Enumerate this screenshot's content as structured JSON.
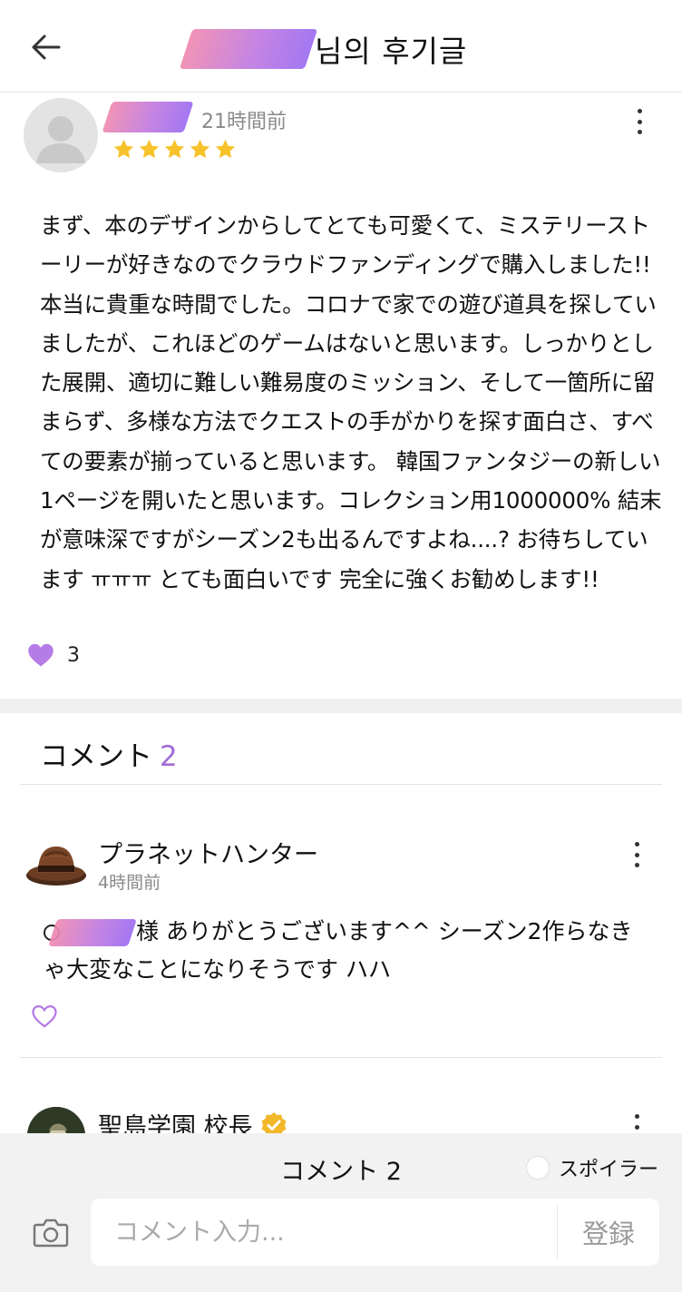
{
  "header": {
    "title": "님의 후기글"
  },
  "review": {
    "time": "21時間前",
    "rating": 5,
    "body": "まず、本のデザインからしてとても可愛くて、ミステリーストーリーが好きなのでクラウドファンディングで購入しました!! 本当に貴重な時間でした。コロナで家での遊び道具を探していましたが、これほどのゲームはないと思います。しっかりとした展開、適切に難しい難易度のミッション、そして一箇所に留まらず、多様な方法でクエストの手がかりを探す面白さ、すべての要素が揃っていると思います。 韓国ファンタジーの新しい1ページを開いたと思います。コレクション用1000000% 結末が意味深ですがシーズン2も出るんですよね....? お待ちしています ㅠㅠㅠ とても面白いです 完全に強くお勧めします!!",
    "likes": "3"
  },
  "comments": {
    "title": "コメント",
    "count": "2",
    "items": [
      {
        "name": "プラネットハンター",
        "time": "4時間前",
        "body_after_redact": "様 ありがとうございます^^ シーズン2作らなきゃ大変なことになりそうです ハハ"
      },
      {
        "name": "聖島学園 校長"
      }
    ]
  },
  "bottom": {
    "title": "コメント 2",
    "spoiler_label": "スポイラー",
    "input_placeholder": "コメント入力...",
    "submit_label": "登録"
  },
  "colors": {
    "accent": "#a06cd5",
    "star": "#f7c22b",
    "heart": "#b57be6"
  }
}
